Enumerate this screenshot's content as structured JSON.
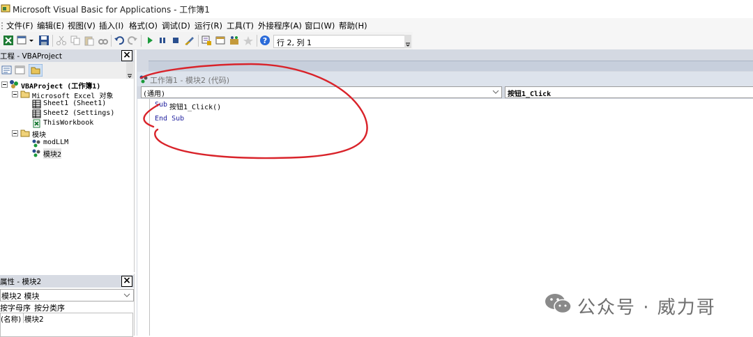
{
  "window": {
    "title": "Microsoft Visual Basic for Applications - 工作簿1"
  },
  "menu": [
    "文件(F)",
    "编辑(E)",
    "视图(V)",
    "插入(I)",
    "格式(O)",
    "调试(D)",
    "运行(R)",
    "工具(T)",
    "外接程序(A)",
    "窗口(W)",
    "帮助(H)"
  ],
  "toolbar": {
    "position": "行 2, 列 1"
  },
  "project": {
    "title": "工程 - VBAProject",
    "root": "VBAProject (工作簿1)",
    "excel_folder": "Microsoft Excel 对象",
    "sheet1": "Sheet1 (Sheet1)",
    "sheet2": "Sheet2 (Settings)",
    "thisworkbook": "ThisWorkbook",
    "modules_folder": "模块",
    "module1": "modLLM",
    "module2": "模块2"
  },
  "properties": {
    "title": "属性 - 模块2",
    "selected": "模块2 模块",
    "tab_alpha": "按字母序",
    "tab_cat": "按分类序",
    "row_name": "(名称)",
    "row_value": "模块2"
  },
  "code_window": {
    "title": "工作簿1 - 模块2 (代码)",
    "object": "(通用)",
    "procedure": "按钮1_Click",
    "line1_kw": "Sub",
    "line1_rest": "按钮1_Click()",
    "line2": "End Sub"
  },
  "watermark": "公众号 · 威力哥",
  "colors": {
    "annotation": "#d9232a",
    "keyword": "#1f1f9e",
    "panel_header": "#d7dbe3"
  }
}
